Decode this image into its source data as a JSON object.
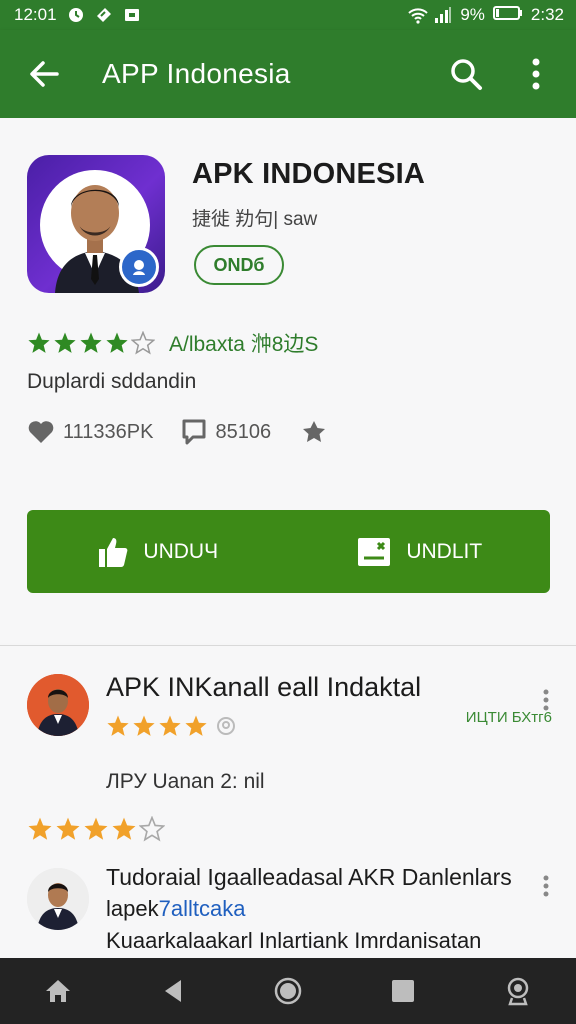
{
  "status_bar": {
    "time_left": "12:01",
    "battery_text": "9%",
    "time_right": "2:32"
  },
  "app_bar": {
    "title": "APP Indonesia"
  },
  "app": {
    "name": "APK INDONESIA",
    "developer": "捷徙 劷句| saw",
    "pill_label": "ONDб",
    "rating_text": "A/lbaxta 浺8边S",
    "subtitle": "Duplardi sddandin",
    "stat_likes": "111336PK",
    "stat_comments": "85106",
    "action_left": "UNDUЧ",
    "action_right": "UNDLIT"
  },
  "reviews": {
    "r1_title": "APK INKanall eall Indaktal",
    "r1_side": "ИЦТИ БХтг6",
    "r1_body": "ЛРУ Uanan 2: nil",
    "r2_line1": "Tudoraial Igaalleadasal AKR Danlenlars",
    "r2_line2_a": "lapek",
    "r2_line2_b": "7alltcaka",
    "r2_line3": "Kuaarkalaakarl Inlartiank Imrdanisatan"
  },
  "colors": {
    "primary": "#2f7d2c",
    "action_green": "#3d8a17",
    "star_green": "#2f8a23",
    "star_orange": "#f1a12a",
    "nav_bg": "#232323"
  }
}
